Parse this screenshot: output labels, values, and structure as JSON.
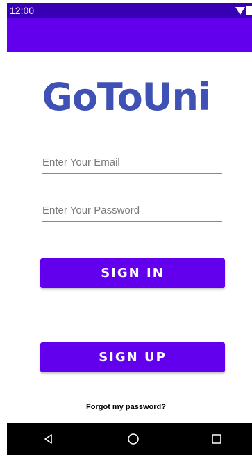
{
  "status_bar": {
    "time": "12:00",
    "icons": [
      "wifi-icon",
      "battery-icon"
    ],
    "color": "#3700b3"
  },
  "app_bar": {
    "color": "#6200ee"
  },
  "logo": {
    "text": "GoToUni",
    "color": "#3f51b5"
  },
  "form": {
    "email_placeholder": "Enter Your Email",
    "email_value": "",
    "password_placeholder": "Enter Your Password",
    "password_value": "",
    "sign_in_label": "SIGN IN",
    "sign_up_label": "SIGN UP",
    "forgot_label": "Forgot my password?",
    "button_color": "#6200ee"
  },
  "nav_bar": {
    "items": [
      "back-icon",
      "home-icon",
      "recents-icon"
    ]
  }
}
